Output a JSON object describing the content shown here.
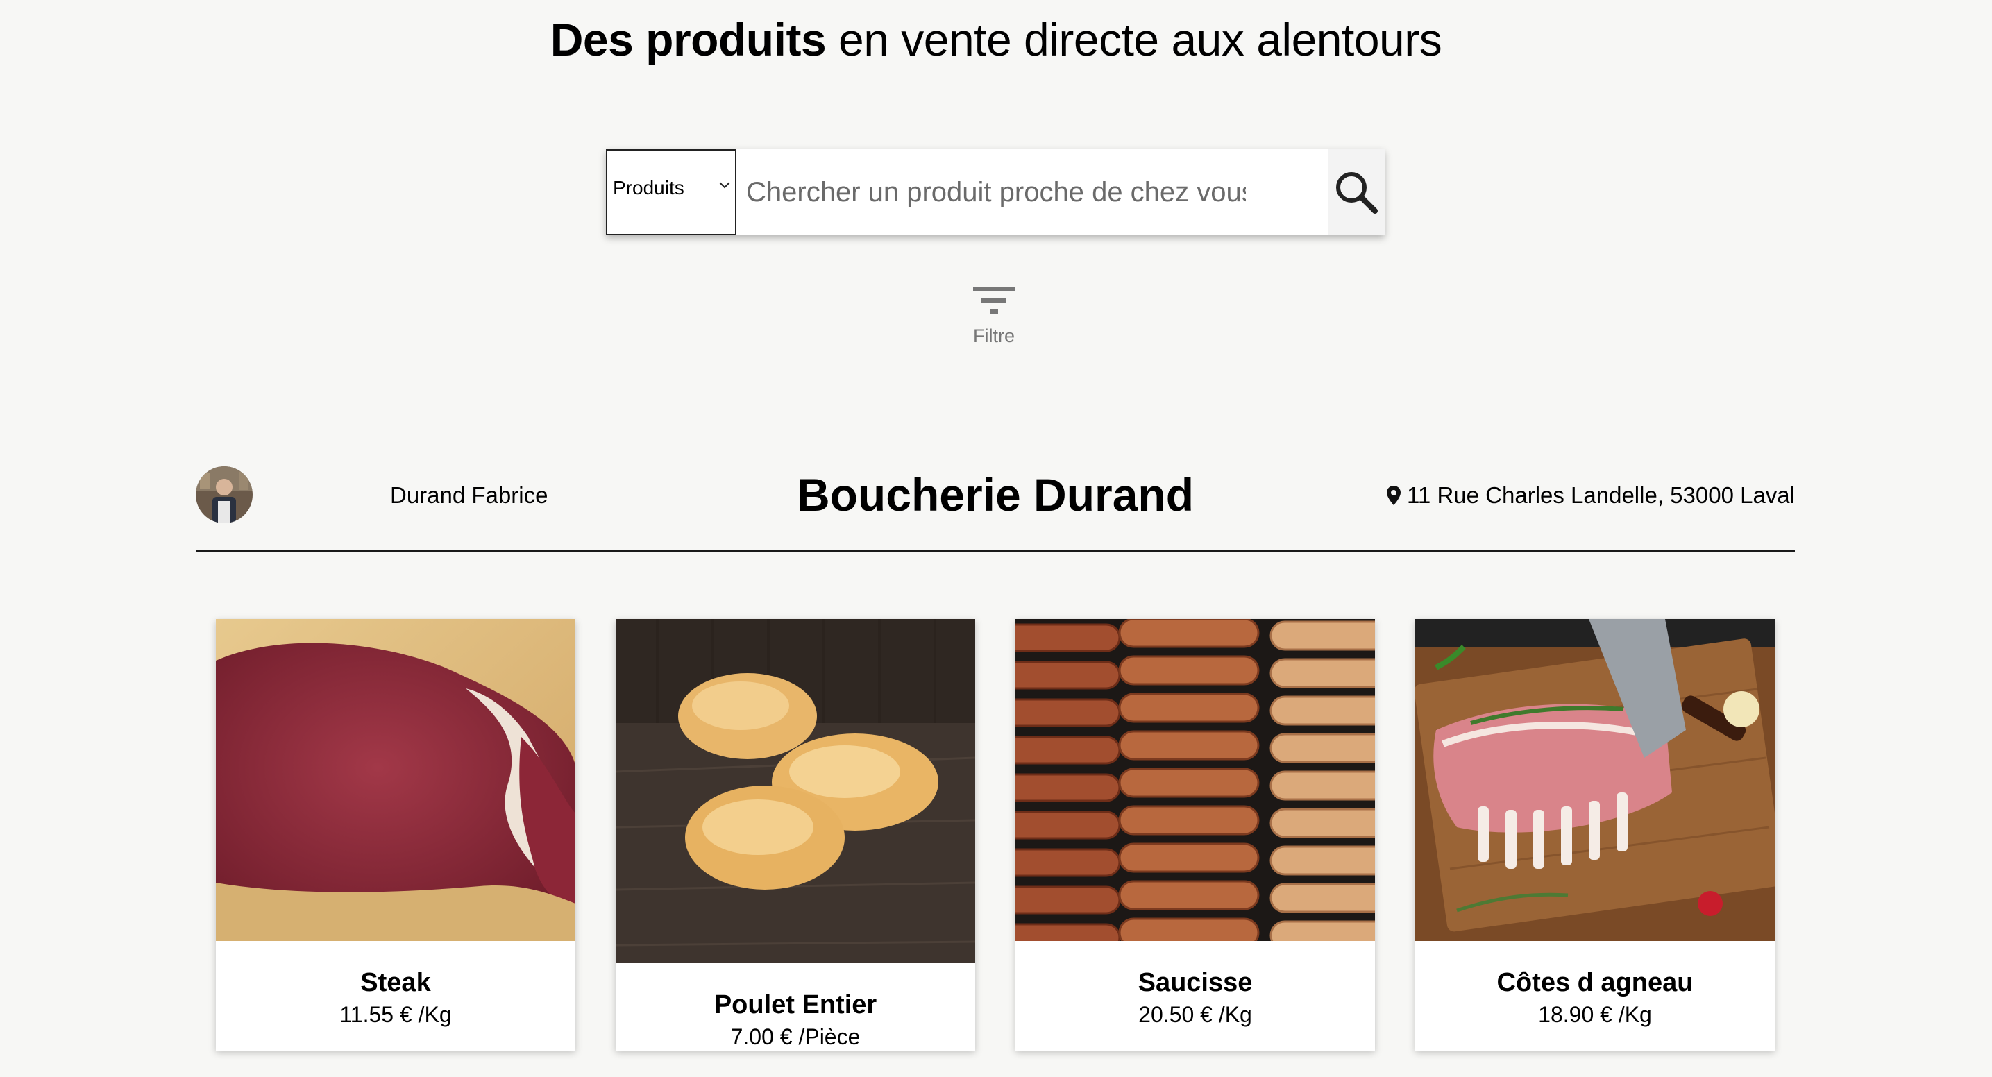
{
  "headline": {
    "bold": "Des produits",
    "rest": " en vente directe aux alentours"
  },
  "search": {
    "category_selected": "Produits",
    "placeholder": "Chercher un produit proche de chez vous",
    "icon": "search-icon"
  },
  "filter": {
    "label": "Filtre",
    "icon": "filter-icon"
  },
  "shop": {
    "owner": "Durand Fabrice",
    "name": "Boucherie Durand",
    "address": "11 Rue Charles Landelle, 53000 Laval",
    "address_icon": "map-pin-icon"
  },
  "products": [
    {
      "name": "Steak",
      "price": "11.55 € /Kg"
    },
    {
      "name": "Poulet Entier",
      "price": "7.00 € /Pièce"
    },
    {
      "name": "Saucisse",
      "price": "20.50 € /Kg"
    },
    {
      "name": "Côtes d agneau",
      "price": "18.90 € /Kg"
    }
  ],
  "colors": {
    "background": "#f7f7f5",
    "divider": "#1a1a1a",
    "muted": "#777777"
  }
}
